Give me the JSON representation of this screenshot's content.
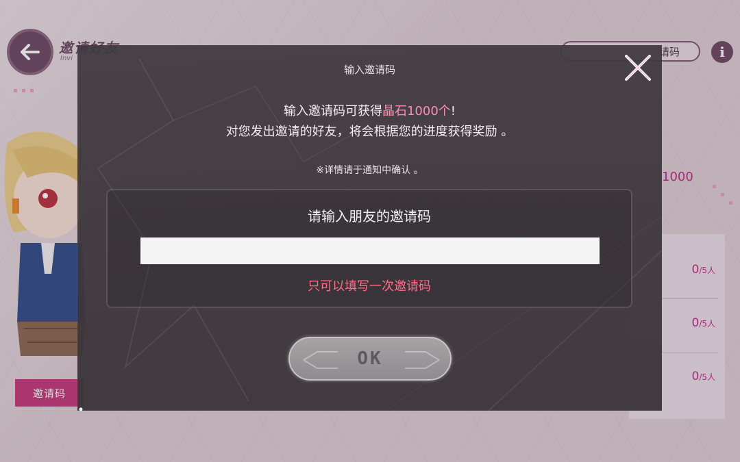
{
  "background": {
    "title": "邀请好友",
    "title_sub": "Invi",
    "pill_text": "请码",
    "info_icon": "i",
    "reward_text": "1000",
    "rows": [
      {
        "count": "0",
        "unit": "/5人"
      },
      {
        "count": "0",
        "unit": "/5人"
      },
      {
        "count": "0",
        "unit": "/5人"
      }
    ],
    "invite_tab_label": "邀请码"
  },
  "dialog": {
    "title": "输入邀请码",
    "message_line1_prefix": "输入邀请码可获得",
    "message_line1_highlight": "晶石1000个",
    "message_line1_suffix": "!",
    "message_line2": "对您发出邀请的好友，将会根据您的进度获得奖励 。",
    "note": "※详情请于通知中确认 。",
    "input_label": "请输入朋友的邀请码",
    "input_value": "",
    "input_warning": "只可以填写一次邀请码",
    "ok_label": "OK"
  },
  "colors": {
    "accent_pink": "#ff8db0",
    "warning_red": "#ff6e8a",
    "brand_purple": "#6b4a63",
    "reward_magenta": "#c0288a"
  },
  "icons": [
    "back-arrow-icon",
    "info-icon",
    "close-icon"
  ]
}
